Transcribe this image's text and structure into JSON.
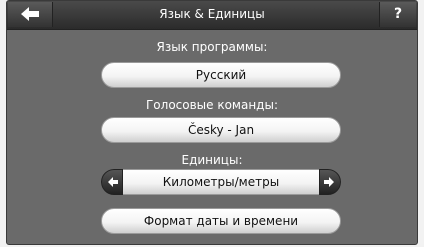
{
  "header": {
    "title": "Язык & Единицы",
    "help_label": "?",
    "back_icon": "left-arrow-icon"
  },
  "language": {
    "label": "Язык программы:",
    "value": "Русский"
  },
  "voice": {
    "label": "Голосовые команды:",
    "value": "Česky - Jan"
  },
  "units": {
    "label": "Единицы:",
    "value": "Километры/метры",
    "prev_icon": "left-arrow-icon",
    "next_icon": "right-arrow-icon"
  },
  "datetime": {
    "button_label": "Формат даты и времени"
  },
  "colors": {
    "background": "#6a6a6a",
    "titlebar": "#2b2b2b",
    "button": "#f4f4f4"
  }
}
